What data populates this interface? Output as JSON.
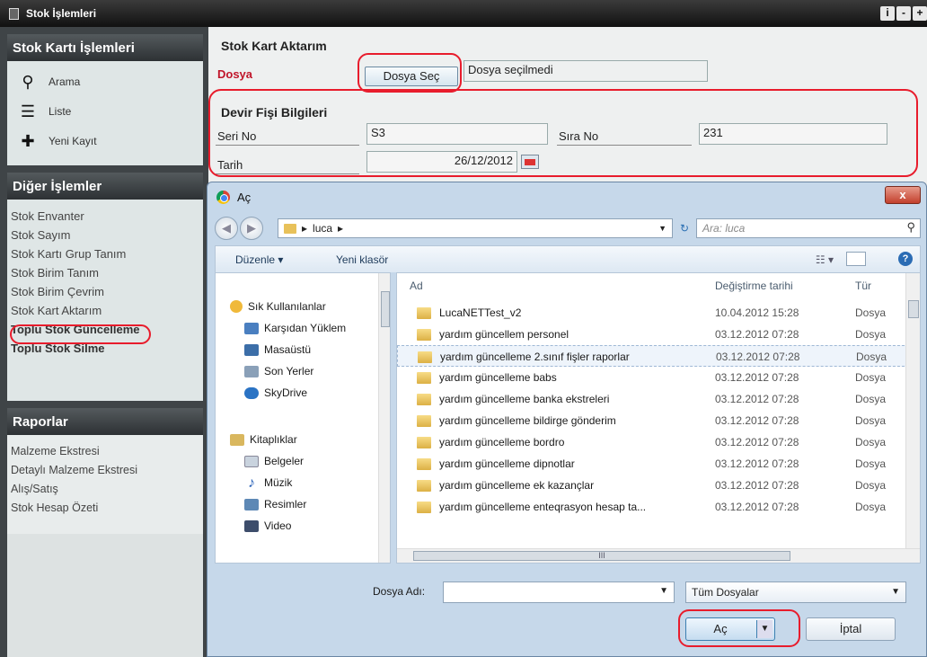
{
  "window": {
    "title": "Stok İşlemleri",
    "controls": [
      "i",
      "-",
      "+"
    ]
  },
  "sidebar": {
    "section1": {
      "title": "Stok Kartı İşlemleri",
      "items": [
        {
          "label": "Arama",
          "icon": "search-icon"
        },
        {
          "label": "Liste",
          "icon": "list-icon"
        },
        {
          "label": "Yeni Kayıt",
          "icon": "new-record-icon"
        }
      ]
    },
    "section2": {
      "title": "Diğer İşlemler",
      "items": [
        {
          "label": "Stok Envanter"
        },
        {
          "label": "Stok Sayım"
        },
        {
          "label": "Stok Kartı Grup Tanım"
        },
        {
          "label": "Stok Birim Tanım"
        },
        {
          "label": "Stok Birim Çevrim"
        },
        {
          "label": "Stok Kart Aktarım"
        },
        {
          "label": "Toplu Stok Güncelleme"
        },
        {
          "label": "Toplu Stok Silme"
        }
      ]
    },
    "section3": {
      "title": "Raporlar",
      "items": [
        {
          "label": "Malzeme Ekstresi"
        },
        {
          "label": "Detaylı Malzeme Ekstresi"
        },
        {
          "label": "Alış/Satış"
        },
        {
          "label": "Stok Hesap Özeti"
        }
      ]
    }
  },
  "main": {
    "title": "Stok Kart Aktarım",
    "dosya_label": "Dosya",
    "choose_button": "Dosya Seç",
    "no_file_text": "Dosya seçilmedi",
    "devir_title": "Devir Fişi Bilgileri",
    "seri_no_label": "Seri No",
    "seri_no_value": "S3",
    "sira_no_label": "Sıra No",
    "sira_no_value": "231",
    "tarih_label": "Tarih",
    "tarih_value": "26/12/2012"
  },
  "dialog": {
    "title": "Aç",
    "close": "x",
    "path": "luca",
    "search_placeholder": "Ara: luca",
    "toolbar": {
      "organize": "Düzenle ▾",
      "new_folder": "Yeni klasör"
    },
    "nav_items": [
      {
        "label": "Sık Kullanılanlar",
        "color": "#f0b93a",
        "indent": 0
      },
      {
        "label": "Karşıdan Yüklem",
        "color": "#4a7fc0",
        "indent": 1
      },
      {
        "label": "Masaüstü",
        "color": "#3c6ea8",
        "indent": 1
      },
      {
        "label": "Son Yerler",
        "color": "#8aa0b8",
        "indent": 1
      },
      {
        "label": "SkyDrive",
        "color": "#2a73c4",
        "indent": 1
      },
      {
        "label": "Kitaplıklar",
        "color": "#d9b75e",
        "indent": 0
      },
      {
        "label": "Belgeler",
        "color": "#c9d3de",
        "indent": 1
      },
      {
        "label": "Müzik",
        "color": "#2a62b8",
        "indent": 1
      },
      {
        "label": "Resimler",
        "color": "#5d88b5",
        "indent": 1
      },
      {
        "label": "Video",
        "color": "#3d4d6b",
        "indent": 1
      }
    ],
    "columns": {
      "name": "Ad",
      "date": "Değiştirme tarihi",
      "type": "Tür"
    },
    "files": [
      {
        "name": "LucaNETTest_v2",
        "date": "10.04.2012 15:28",
        "type": "Dosya"
      },
      {
        "name": "yardım güncellem personel",
        "date": "03.12.2012 07:28",
        "type": "Dosya"
      },
      {
        "name": "yardım güncelleme 2.sınıf fişler raporlar",
        "date": "03.12.2012 07:28",
        "type": "Dosya"
      },
      {
        "name": "yardım güncelleme babs",
        "date": "03.12.2012 07:28",
        "type": "Dosya"
      },
      {
        "name": "yardım güncelleme banka ekstreleri",
        "date": "03.12.2012 07:28",
        "type": "Dosya"
      },
      {
        "name": "yardım güncelleme bildirge gönderim",
        "date": "03.12.2012 07:28",
        "type": "Dosya"
      },
      {
        "name": "yardım güncelleme bordro",
        "date": "03.12.2012 07:28",
        "type": "Dosya"
      },
      {
        "name": "yardım güncelleme dipnotlar",
        "date": "03.12.2012 07:28",
        "type": "Dosya"
      },
      {
        "name": "yardım güncelleme ek kazançlar",
        "date": "03.12.2012 07:28",
        "type": "Dosya"
      },
      {
        "name": "yardım güncelleme enteqrasyon hesap ta...",
        "date": "03.12.2012 07:28",
        "type": "Dosya"
      }
    ],
    "filename_label": "Dosya Adı:",
    "filename_value": "",
    "filetype": "Tüm Dosyalar",
    "open_button": "Aç",
    "cancel_button": "İptal"
  },
  "colors": {
    "highlight": "#e81c2c",
    "sidebar_bg": "#3f4447",
    "label_red": "#c0152a"
  }
}
